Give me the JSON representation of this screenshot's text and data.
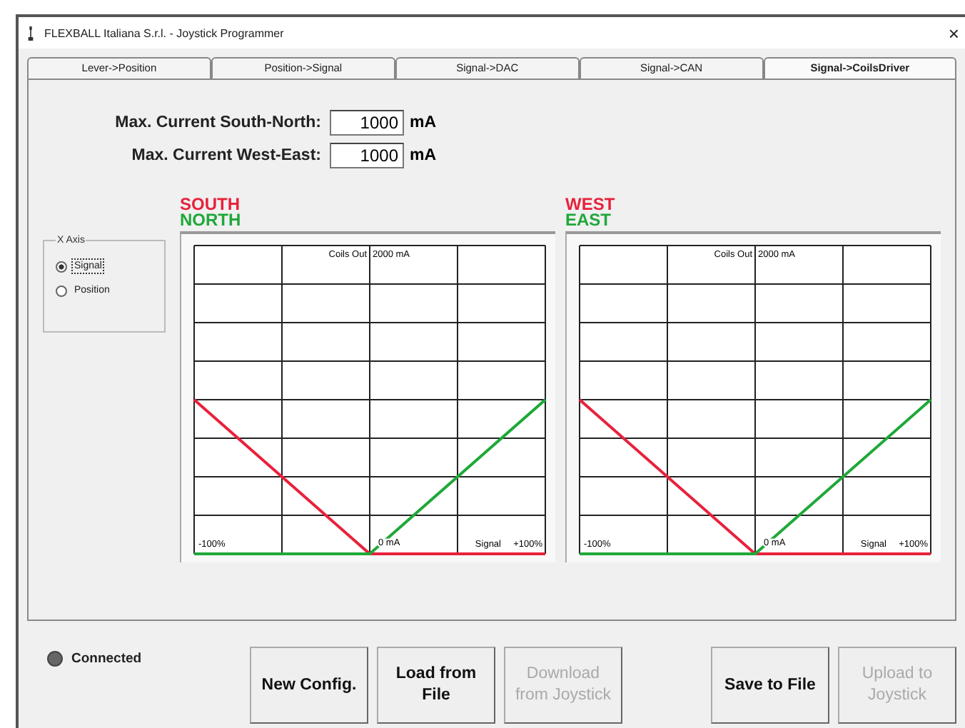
{
  "window": {
    "title": "FLEXBALL Italiana S.r.l. - Joystick Programmer",
    "close": "×"
  },
  "tabs": [
    {
      "label": "Lever->Position",
      "selected": false
    },
    {
      "label": "Position->Signal",
      "selected": false
    },
    {
      "label": "Signal->DAC",
      "selected": false
    },
    {
      "label": "Signal->CAN",
      "selected": false
    },
    {
      "label": "Signal->CoilsDriver",
      "selected": true
    }
  ],
  "max_current": [
    {
      "label": "Max. Current South-North:",
      "value": "1000",
      "unit": "mA"
    },
    {
      "label": "Max. Current West-East:",
      "value": "1000",
      "unit": "mA"
    }
  ],
  "x_axis": {
    "title": "X Axis",
    "options": [
      {
        "label": "Signal",
        "selected": true
      },
      {
        "label": "Position",
        "selected": false
      }
    ]
  },
  "charts": [
    {
      "series": [
        {
          "name": "SOUTH",
          "color": "#e8213c"
        },
        {
          "name": "NORTH",
          "color": "#1fa83a"
        }
      ],
      "ylabel": "Coils Out",
      "top_label": "2000 mA",
      "left_label": "-100%",
      "zero_label": "0 mA",
      "xlabel": "Signal",
      "right_label": "+100%"
    },
    {
      "series": [
        {
          "name": "WEST",
          "color": "#e8213c"
        },
        {
          "name": "EAST",
          "color": "#1fa83a"
        }
      ],
      "ylabel": "Coils Out",
      "top_label": "2000 mA",
      "left_label": "-100%",
      "zero_label": "0 mA",
      "xlabel": "Signal",
      "right_label": "+100%"
    }
  ],
  "status": {
    "label": "Connected",
    "on": false
  },
  "buttons": [
    {
      "label": "New Config.",
      "disabled": false
    },
    {
      "label": "Load from File",
      "disabled": false
    },
    {
      "label": "Download from Joystick",
      "disabled": true
    },
    {
      "label": "Save to File",
      "disabled": false
    },
    {
      "label": "Upload to Joystick",
      "disabled": true
    }
  ]
}
